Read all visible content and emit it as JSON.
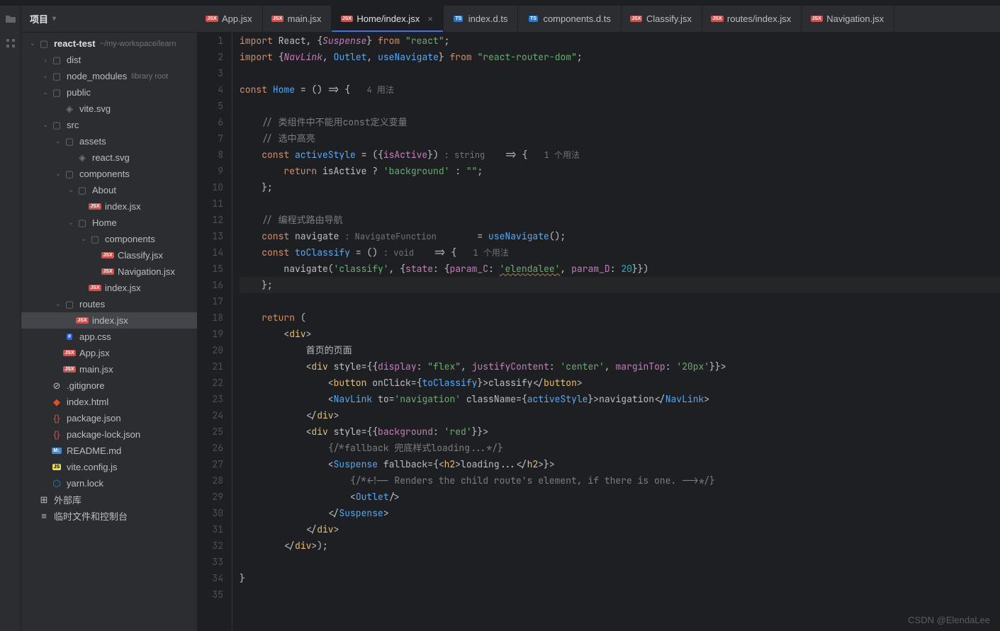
{
  "sidebar": {
    "title": "项目",
    "project_name": "react-test",
    "project_path": "~/my-workspace/learn",
    "library_root": "library root",
    "nodes": {
      "dist": "dist",
      "node_modules": "node_modules",
      "public": "public",
      "vite_svg": "vite.svg",
      "src": "src",
      "assets": "assets",
      "react_svg": "react.svg",
      "components": "components",
      "about": "About",
      "about_index": "index.jsx",
      "home": "Home",
      "home_components": "components",
      "classify": "Classify.jsx",
      "navigation": "Navigation.jsx",
      "home_index": "index.jsx",
      "routes": "routes",
      "routes_index": "index.jsx",
      "app_css": "app.css",
      "app_jsx": "App.jsx",
      "main_jsx": "main.jsx",
      "gitignore": ".gitignore",
      "index_html": "index.html",
      "package_json": "package.json",
      "package_lock": "package-lock.json",
      "readme": "README.md",
      "vite_config": "vite.config.js",
      "yarn_lock": "yarn.lock",
      "external_lib": "外部库",
      "scratches": "临时文件和控制台"
    }
  },
  "tabs": {
    "app": "App.jsx",
    "main": "main.jsx",
    "home": "Home/index.jsx",
    "index_d_ts": "index.d.ts",
    "components_d_ts": "components.d.ts",
    "classify": "Classify.jsx",
    "routes": "routes/index.jsx",
    "navigation": "Navigation.jsx"
  },
  "code": {
    "l1_import": "import",
    "l1_react": " React, {",
    "l1_suspense": "Suspense",
    "l1_from": "} ",
    "l1_from_kw": "from",
    "l1_react_str": " \"react\"",
    "l1_end": ";",
    "l2_import": "import",
    "l2_brace": " {",
    "l2_navlink": "NavLink",
    "l2_c1": ", ",
    "l2_outlet": "Outlet",
    "l2_c2": ", ",
    "l2_use_navigate": "useNavigate",
    "l2_brace_close": "} ",
    "l2_from": "from",
    "l2_router_str": " \"react-router-dom\"",
    "l2_end": ";",
    "l4_const": "const",
    "l4_home": " Home",
    "l4_eq": " = () => {   ",
    "l4_hint": "4 用法",
    "l6_cmt": "    // 类组件中不能用const定义变量",
    "l7_cmt": "    // 选中高亮",
    "l8_const": "    const",
    "l8_activeStyle": " activeStyle",
    "l8_eq": " = ({",
    "l8_isActive": "isActive",
    "l8_close": "}) ",
    "l8_type_hint": ": string    ",
    "l8_arrow": "=> {   ",
    "l8_usage": "1 个用法",
    "l9_return": "        return",
    "l9_isActive": " isActive ? ",
    "l9_bg": "'background'",
    "l9_else": " : ",
    "l9_empty": "\"\"",
    "l9_end": ";",
    "l10_close": "    };",
    "l12_cmt": "    // 编程式路由导航",
    "l13_const": "    const",
    "l13_navigate": " navigate ",
    "l13_type_hint": ": NavigateFunction        ",
    "l13_eq": "= ",
    "l13_useNavigate": "useNavigate",
    "l13_call": "();",
    "l14_const": "    const",
    "l14_toClassify": " toClassify",
    "l14_eq": " = () ",
    "l14_void_hint": ": void    ",
    "l14_arrow": "=> {   ",
    "l14_usage": "1 个用法",
    "l15_nav": "        navigate(",
    "l15_classify": "'classify'",
    "l15_c": ", {",
    "l15_state": "state",
    "l15_colon": ": {",
    "l15_paramc": "param_C",
    "l15_colon2": ": ",
    "l15_el": "'elendalee'",
    "l15_c2": ", ",
    "l15_paramd": "param_D",
    "l15_colon3": ": ",
    "l15_20": "20",
    "l15_end": "}})",
    "l16_close": "    };",
    "l18_return": "    return",
    "l18_paren": " (",
    "l19_div": "        <",
    "l19_div_tag": "div",
    "l19_close": ">",
    "l20_text": "            首页的页面",
    "l21_open": "            <",
    "l21_div": "div",
    "l21_style": " style",
    "l21_eq": "={{",
    "l21_display": "display",
    "l21_c1": ": ",
    "l21_flex": "\"flex\"",
    "l21_c2": ", ",
    "l21_jc": "justifyContent",
    "l21_c3": ": ",
    "l21_center": "'center'",
    "l21_c4": ", ",
    "l21_mt": "marginTop",
    "l21_c5": ": ",
    "l21_20px": "'20px'",
    "l21_close": "}}>",
    "l22_open": "                <",
    "l22_button": "button",
    "l22_onclick": " onClick",
    "l22_eq": "={",
    "l22_toClassify": "toClassify",
    "l22_close": "}>classify</",
    "l22_button2": "button",
    "l22_end": ">",
    "l23_open": "                <",
    "l23_navlink": "NavLink",
    "l23_to": " to",
    "l23_eq": "=",
    "l23_nav_str": "'navigation'",
    "l23_cls": " className",
    "l23_eq2": "={",
    "l23_activeStyle": "activeStyle",
    "l23_close": "}>navigation</",
    "l23_navlink2": "NavLink",
    "l23_end": ">",
    "l24_close": "            </",
    "l24_div": "div",
    "l24_end": ">",
    "l25_open": "            <",
    "l25_div": "div",
    "l25_style": " style",
    "l25_eq": "={{",
    "l25_bg": "background",
    "l25_c": ": ",
    "l25_red": "'red'",
    "l25_close": "}}>",
    "l26_cmt": "                {/*fallback 兜底样式loading...*/}",
    "l27_open": "                <",
    "l27_suspense": "Suspense",
    "l27_fb": " fallback",
    "l27_eq": "={<",
    "l27_h2": "h2",
    "l27_txt": ">loading...</",
    "l27_h2b": "h2",
    "l27_close": ">}>",
    "l28_cmt": "                    {/*<!-- Renders the child route's element, if there is one. -->*/}",
    "l29_open": "                    <",
    "l29_outlet": "Outlet",
    "l29_close": "/>",
    "l30_close": "                </",
    "l30_suspense": "Suspense",
    "l30_end": ">",
    "l31_close": "            </",
    "l31_div": "div",
    "l31_end": ">",
    "l32_close": "        </",
    "l32_div": "div",
    "l32_end": ">);",
    "l34_brace": "}"
  },
  "watermark": "CSDN @ElendaLee"
}
